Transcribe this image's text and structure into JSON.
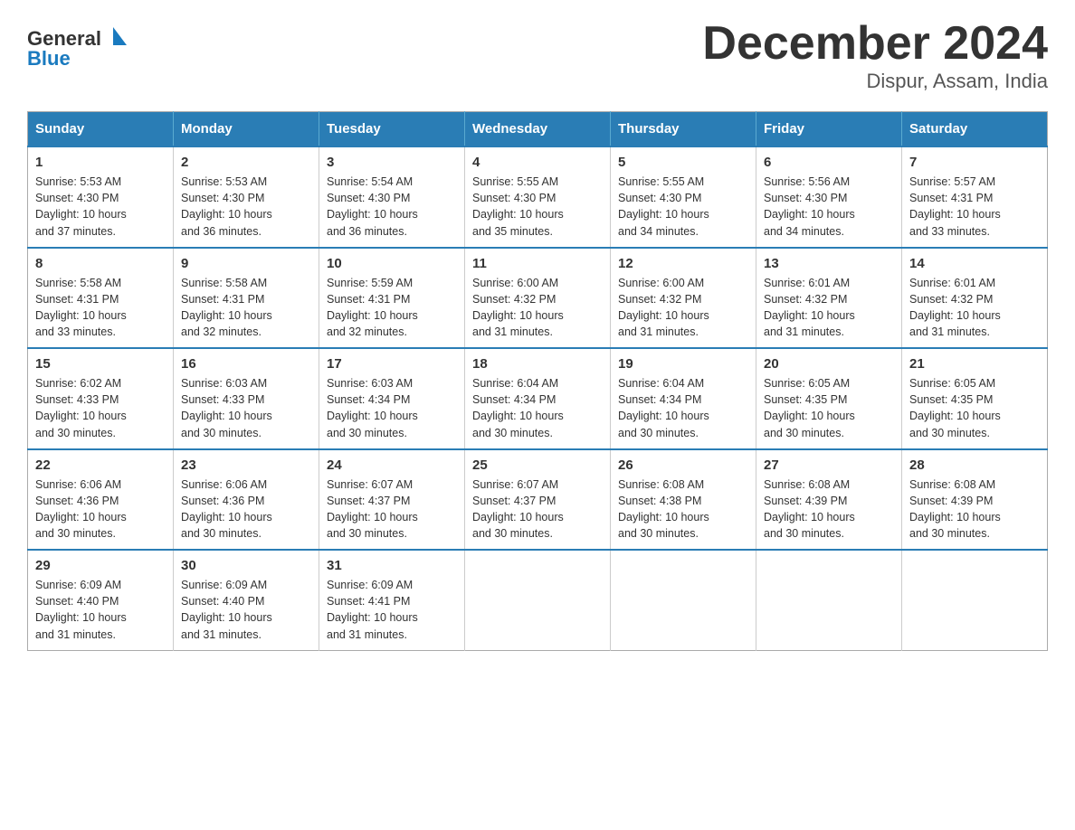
{
  "header": {
    "logo_general": "General",
    "logo_blue": "Blue",
    "title": "December 2024",
    "subtitle": "Dispur, Assam, India"
  },
  "calendar": {
    "days_of_week": [
      "Sunday",
      "Monday",
      "Tuesday",
      "Wednesday",
      "Thursday",
      "Friday",
      "Saturday"
    ],
    "weeks": [
      [
        {
          "day": "1",
          "sunrise": "5:53 AM",
          "sunset": "4:30 PM",
          "daylight": "10 hours and 37 minutes."
        },
        {
          "day": "2",
          "sunrise": "5:53 AM",
          "sunset": "4:30 PM",
          "daylight": "10 hours and 36 minutes."
        },
        {
          "day": "3",
          "sunrise": "5:54 AM",
          "sunset": "4:30 PM",
          "daylight": "10 hours and 36 minutes."
        },
        {
          "day": "4",
          "sunrise": "5:55 AM",
          "sunset": "4:30 PM",
          "daylight": "10 hours and 35 minutes."
        },
        {
          "day": "5",
          "sunrise": "5:55 AM",
          "sunset": "4:30 PM",
          "daylight": "10 hours and 34 minutes."
        },
        {
          "day": "6",
          "sunrise": "5:56 AM",
          "sunset": "4:30 PM",
          "daylight": "10 hours and 34 minutes."
        },
        {
          "day": "7",
          "sunrise": "5:57 AM",
          "sunset": "4:31 PM",
          "daylight": "10 hours and 33 minutes."
        }
      ],
      [
        {
          "day": "8",
          "sunrise": "5:58 AM",
          "sunset": "4:31 PM",
          "daylight": "10 hours and 33 minutes."
        },
        {
          "day": "9",
          "sunrise": "5:58 AM",
          "sunset": "4:31 PM",
          "daylight": "10 hours and 32 minutes."
        },
        {
          "day": "10",
          "sunrise": "5:59 AM",
          "sunset": "4:31 PM",
          "daylight": "10 hours and 32 minutes."
        },
        {
          "day": "11",
          "sunrise": "6:00 AM",
          "sunset": "4:32 PM",
          "daylight": "10 hours and 31 minutes."
        },
        {
          "day": "12",
          "sunrise": "6:00 AM",
          "sunset": "4:32 PM",
          "daylight": "10 hours and 31 minutes."
        },
        {
          "day": "13",
          "sunrise": "6:01 AM",
          "sunset": "4:32 PM",
          "daylight": "10 hours and 31 minutes."
        },
        {
          "day": "14",
          "sunrise": "6:01 AM",
          "sunset": "4:32 PM",
          "daylight": "10 hours and 31 minutes."
        }
      ],
      [
        {
          "day": "15",
          "sunrise": "6:02 AM",
          "sunset": "4:33 PM",
          "daylight": "10 hours and 30 minutes."
        },
        {
          "day": "16",
          "sunrise": "6:03 AM",
          "sunset": "4:33 PM",
          "daylight": "10 hours and 30 minutes."
        },
        {
          "day": "17",
          "sunrise": "6:03 AM",
          "sunset": "4:34 PM",
          "daylight": "10 hours and 30 minutes."
        },
        {
          "day": "18",
          "sunrise": "6:04 AM",
          "sunset": "4:34 PM",
          "daylight": "10 hours and 30 minutes."
        },
        {
          "day": "19",
          "sunrise": "6:04 AM",
          "sunset": "4:34 PM",
          "daylight": "10 hours and 30 minutes."
        },
        {
          "day": "20",
          "sunrise": "6:05 AM",
          "sunset": "4:35 PM",
          "daylight": "10 hours and 30 minutes."
        },
        {
          "day": "21",
          "sunrise": "6:05 AM",
          "sunset": "4:35 PM",
          "daylight": "10 hours and 30 minutes."
        }
      ],
      [
        {
          "day": "22",
          "sunrise": "6:06 AM",
          "sunset": "4:36 PM",
          "daylight": "10 hours and 30 minutes."
        },
        {
          "day": "23",
          "sunrise": "6:06 AM",
          "sunset": "4:36 PM",
          "daylight": "10 hours and 30 minutes."
        },
        {
          "day": "24",
          "sunrise": "6:07 AM",
          "sunset": "4:37 PM",
          "daylight": "10 hours and 30 minutes."
        },
        {
          "day": "25",
          "sunrise": "6:07 AM",
          "sunset": "4:37 PM",
          "daylight": "10 hours and 30 minutes."
        },
        {
          "day": "26",
          "sunrise": "6:08 AM",
          "sunset": "4:38 PM",
          "daylight": "10 hours and 30 minutes."
        },
        {
          "day": "27",
          "sunrise": "6:08 AM",
          "sunset": "4:39 PM",
          "daylight": "10 hours and 30 minutes."
        },
        {
          "day": "28",
          "sunrise": "6:08 AM",
          "sunset": "4:39 PM",
          "daylight": "10 hours and 30 minutes."
        }
      ],
      [
        {
          "day": "29",
          "sunrise": "6:09 AM",
          "sunset": "4:40 PM",
          "daylight": "10 hours and 31 minutes."
        },
        {
          "day": "30",
          "sunrise": "6:09 AM",
          "sunset": "4:40 PM",
          "daylight": "10 hours and 31 minutes."
        },
        {
          "day": "31",
          "sunrise": "6:09 AM",
          "sunset": "4:41 PM",
          "daylight": "10 hours and 31 minutes."
        },
        null,
        null,
        null,
        null
      ]
    ],
    "labels": {
      "sunrise": "Sunrise:",
      "sunset": "Sunset:",
      "daylight": "Daylight:"
    }
  }
}
